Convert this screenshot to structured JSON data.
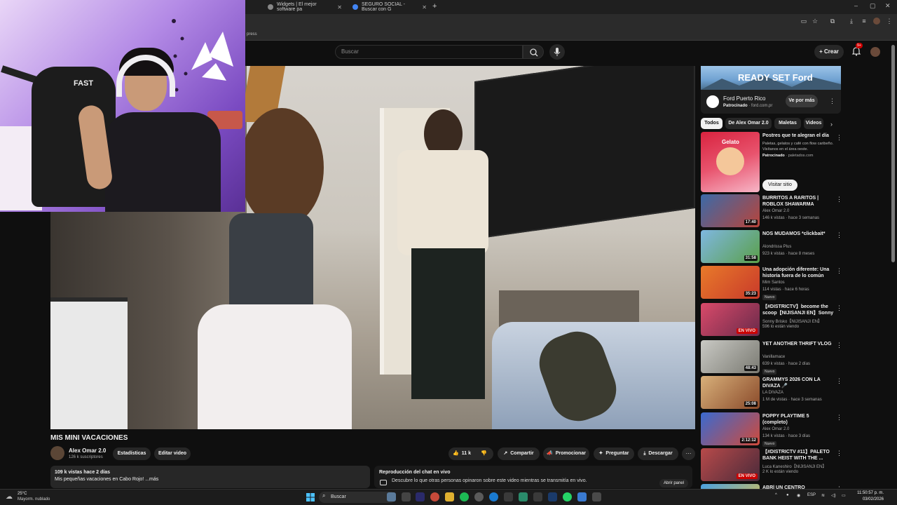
{
  "browser": {
    "tabs": [
      {
        "label": "Widgets | El mejor software pa"
      },
      {
        "label": "SEGURO SOCIAL - Buscar con G"
      }
    ],
    "new_tab": "+",
    "window_controls": [
      "–",
      "▢",
      "✕"
    ],
    "bookmark_text": "press"
  },
  "youtube": {
    "search_placeholder": "Buscar",
    "create_label": "Crear",
    "notifications_badge": "9+"
  },
  "webcam": {
    "chair_label": "FAST"
  },
  "video": {
    "title": "MIS MINI VACACIONES",
    "channel": "Alex Omar 2.0",
    "subscribers": "126 k suscriptores",
    "stats_btn": "Estadísticas",
    "edit_btn": "Editar video",
    "likes": "11 k",
    "share": "Compartir",
    "promote": "Promocionar",
    "ask": "Preguntar",
    "download": "Descargar",
    "more": "···"
  },
  "description": {
    "stats": "109 k vistas  hace 2 días",
    "text": "Mis pequeñas vacaciones en Cabo Rojo! ...más"
  },
  "chat": {
    "title": "Reproducción del chat en vivo",
    "desc": "Descubre lo que otras personas opinaron sobre este video mientras se transmitía en vivo.",
    "button": "Abrir panel"
  },
  "sidebar": {
    "ad_banner": {
      "text": "READY SET Ford"
    },
    "ad_card": {
      "name": "Ford Puerto Rico",
      "sponsored": "Patrocinado",
      "url": "ford.com.pr",
      "button": "Ve por más"
    },
    "chips": [
      "Todos",
      "De Alex Omar 2.0",
      "Maletas",
      "Videos"
    ],
    "ad2": {
      "title": "Postres que te alegran el día",
      "desc": "Paletas, gelatos y café con flow caribeño. Visítanos en el área oeste.",
      "sponsored": "Patrocinado",
      "url": "paletados.com",
      "button": "Visitar sitio",
      "thumb_text": "Gelato"
    },
    "recommendations": [
      {
        "title": "BURRITOS A RARITOS | ROBLOX SHAWARMA",
        "channel": "Alex Omar 2.0",
        "meta": "146 k vistas · hace 3 semanas",
        "duration": "17:40",
        "new": "",
        "color1": "#3b6aa8",
        "color2": "#b8443a"
      },
      {
        "title": "NOS MUDAMOS *clickbait*",
        "channel": "Alondrissa Plus",
        "meta": "923 k vistas · hace 8 meses",
        "duration": "31:58",
        "new": "",
        "color1": "#7fb7e0",
        "color2": "#5aa04a"
      },
      {
        "title": "Una adopción diferente: Una historia fuera de lo común",
        "channel": "Mim Santos",
        "meta": "114 vistas · hace 6 horas",
        "duration": "35:23",
        "new": "Nuevo",
        "color1": "#e87a2a",
        "color2": "#c93a2a"
      },
      {
        "title": "【#DISTRICTV】become the scoop【NIJISANJI EN】Sonny ...",
        "channel": "Sonny Brisko【NIJISANJI EN】",
        "meta": "596 lo están viendo",
        "duration": "EN VIVO",
        "new": "",
        "color1": "#d94a6a",
        "color2": "#6a2a4a"
      },
      {
        "title": "YET ANOTHER THRIFT VLOG",
        "channel": "Vanillamace",
        "meta": "639 k vistas · hace 2 días",
        "duration": "48:43",
        "new": "Nuevo",
        "color1": "#c9c9c4",
        "color2": "#7a7a72"
      },
      {
        "title": "GRAMMYS 2026 CON LA DIVAZA 🎤",
        "channel": "LA DIVAZA",
        "meta": "1 M de vistas · hace 3 semanas",
        "duration": "25:08",
        "new": "",
        "color1": "#d8b07a",
        "color2": "#8a4a2a"
      },
      {
        "title": "POPPY PLAYTIME 5 (completo)",
        "channel": "Alex Omar 2.0",
        "meta": "134 k vistas · hace 3 días",
        "duration": "2:12:12",
        "new": "Nuevo",
        "color1": "#3a6ad0",
        "color2": "#d04a3a"
      },
      {
        "title": "【#DISTRICTV #11】PALETO BANK HEIST WITH THE ...",
        "channel": "Luca Kaneshiro【NIJISANJI EN】",
        "meta": "2 K lo están viendo",
        "duration": "EN VIVO",
        "new": "",
        "color1": "#b84a4a",
        "color2": "#4a2a3a"
      },
      {
        "title": "ABRÍ UN CENTRO COMERCIAL",
        "channel": "",
        "meta": "",
        "duration": "",
        "new": "",
        "color1": "#4aa0e0",
        "color2": "#e0c04a"
      }
    ]
  },
  "taskbar": {
    "weather_temp": "25°C",
    "weather_desc": "Mayorm. nublado",
    "search": "Buscar",
    "lang": "ESP",
    "time": "11:50:57 p. m.",
    "date": "03/02/2026"
  }
}
